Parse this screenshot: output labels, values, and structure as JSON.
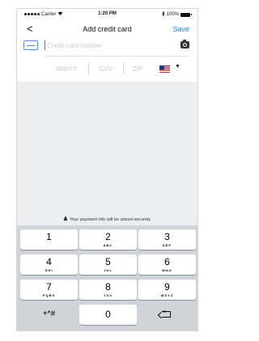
{
  "status_bar": {
    "carrier": "Carrier",
    "time": "1:20 PM",
    "battery": "100%",
    "icons": [
      "signal-dots-icon",
      "wifi-icon",
      "bluetooth-icon",
      "battery-icon"
    ]
  },
  "nav": {
    "back_label": "<",
    "title": "Add credit card",
    "save_label": "Save"
  },
  "form": {
    "card_number_placeholder": "Credit card number",
    "expiry_placeholder": "MM/YY",
    "cvv_placeholder": "CVV",
    "zip_placeholder": "ZIP",
    "country_flag": "us-flag-icon"
  },
  "secure_message": "Your payment info will be stored securely",
  "keypad": {
    "keys": [
      {
        "num": "1",
        "letters": ""
      },
      {
        "num": "2",
        "letters": "ABC"
      },
      {
        "num": "3",
        "letters": "DEF"
      },
      {
        "num": "4",
        "letters": "GHI"
      },
      {
        "num": "5",
        "letters": "JKL"
      },
      {
        "num": "6",
        "letters": "MNO"
      },
      {
        "num": "7",
        "letters": "PQRS"
      },
      {
        "num": "8",
        "letters": "TUV"
      },
      {
        "num": "9",
        "letters": "WXYZ"
      },
      {
        "num": "0",
        "letters": ""
      }
    ],
    "symbols_label": "+*#",
    "delete_icon": "backspace-icon"
  },
  "colors": {
    "accent": "#1e88e5",
    "keyboard_bg": "#d0d3d9",
    "content_bg": "#edeef0"
  }
}
